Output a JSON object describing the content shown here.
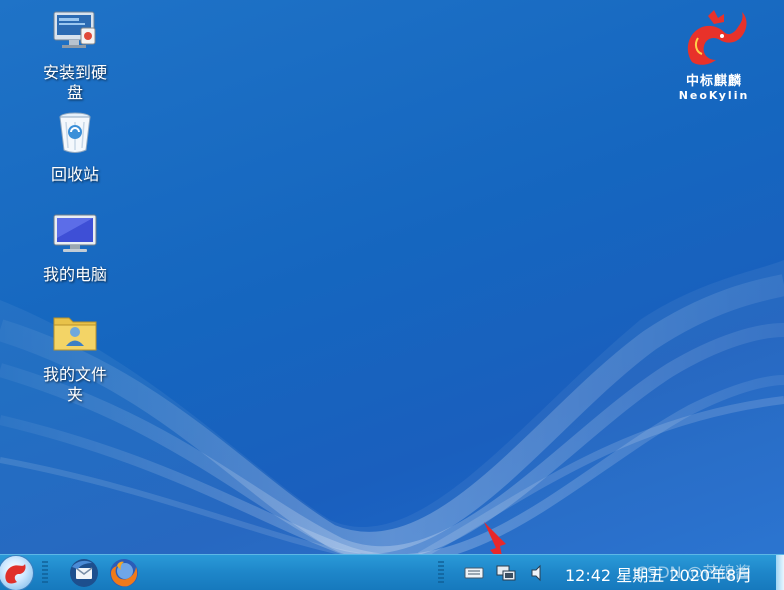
{
  "desktop": {
    "icons": [
      {
        "label": "安装到硬盘",
        "icon": "install-disk-icon"
      },
      {
        "label": "回收站",
        "icon": "recycle-bin-icon"
      },
      {
        "label": "我的电脑",
        "icon": "computer-icon"
      },
      {
        "label": "我的文件夹",
        "icon": "user-folder-icon"
      }
    ],
    "logo": {
      "name_cn": "中标麒麟",
      "name_en": "NeoKylin"
    }
  },
  "taskbar": {
    "start_icon": "kylin-start-icon",
    "launchers": [
      {
        "icon": "thunderbird-icon"
      },
      {
        "icon": "firefox-icon"
      }
    ],
    "tray": [
      {
        "icon": "keyboard-icon"
      },
      {
        "icon": "network-icon"
      },
      {
        "icon": "volume-icon"
      }
    ],
    "clock": "12:42 星期五 2020年8月",
    "watermark": "CSDN @芒锦酱"
  },
  "colors": {
    "desktop_blue": "#1566bf",
    "taskbar_blue": "#1e86c9",
    "annotation_red": "#e8282a"
  }
}
